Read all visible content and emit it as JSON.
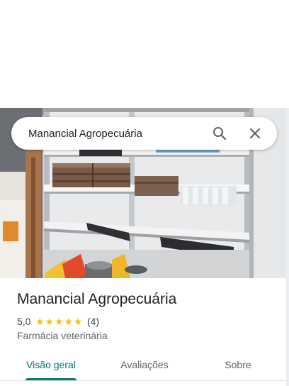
{
  "search": {
    "query": "Manancial Agropecuária",
    "search_icon": "search-icon",
    "close_icon": "close-icon"
  },
  "place": {
    "name": "Manancial Agropecuária",
    "rating": "5,0",
    "rating_stars": 5,
    "review_count": "(4)",
    "category": "Farmácia veterinária"
  },
  "tabs": [
    {
      "label": "Visão geral",
      "active": true
    },
    {
      "label": "Avaliações",
      "active": false
    },
    {
      "label": "Sobre",
      "active": false
    }
  ],
  "colors": {
    "accent": "#01796f",
    "star": "#fbbc04",
    "text_primary": "#202124",
    "text_secondary": "#5f6368"
  }
}
